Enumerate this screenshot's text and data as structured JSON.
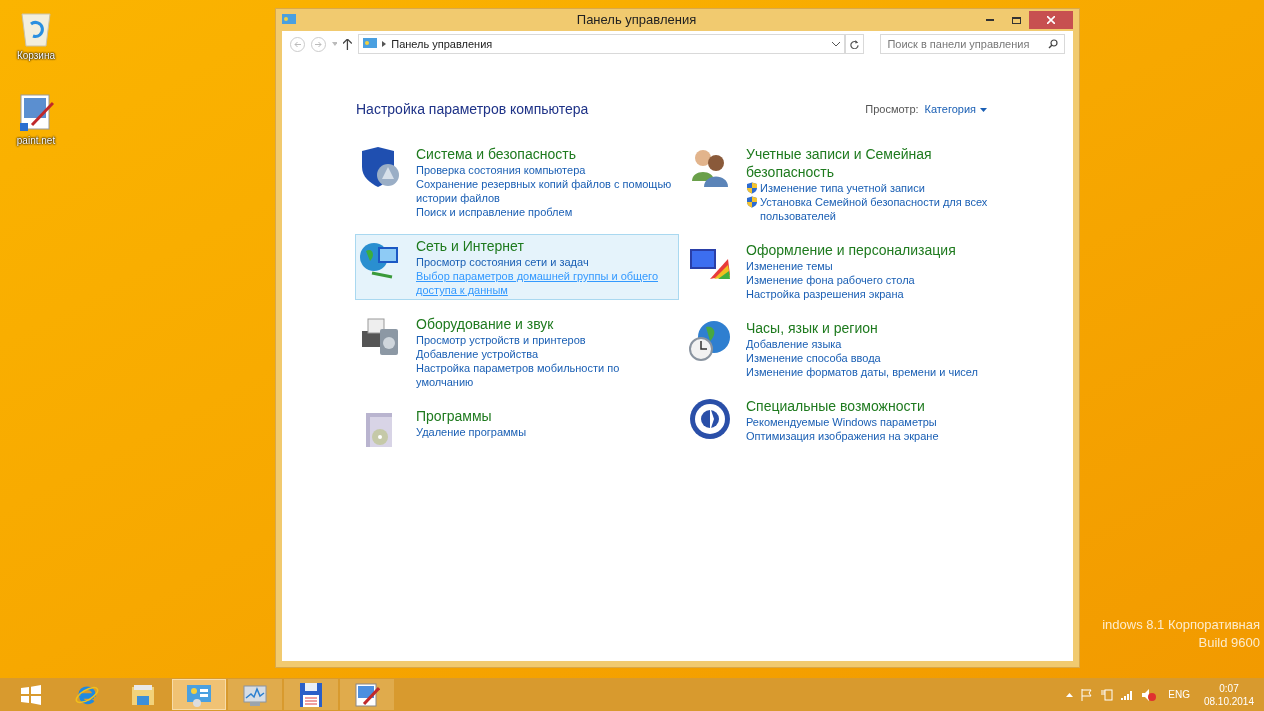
{
  "desktop_icons": [
    {
      "kind": "recycle",
      "label": "Корзина"
    },
    {
      "kind": "paint",
      "label": "paint.net"
    }
  ],
  "window": {
    "title": "Панель управления",
    "address": {
      "path": "Панель управления"
    },
    "search": {
      "placeholder": "Поиск в панели управления"
    },
    "heading": "Настройка параметров компьютера",
    "view_label": "Просмотр:",
    "view_value": "Категория",
    "columns": [
      [
        {
          "kind": "security",
          "title": "Система и безопасность",
          "selected": false,
          "links": [
            {
              "text": "Проверка состояния компьютера",
              "shield": false,
              "hovered": false
            },
            {
              "text": "Сохранение резервных копий файлов с помощью истории файлов",
              "shield": false,
              "hovered": false
            },
            {
              "text": "Поиск и исправление проблем",
              "shield": false,
              "hovered": false
            }
          ]
        },
        {
          "kind": "network",
          "title": "Сеть и Интернет",
          "selected": true,
          "links": [
            {
              "text": "Просмотр состояния сети и задач",
              "shield": false,
              "hovered": false
            },
            {
              "text": "Выбор параметров домашней группы и общего доступа к данным",
              "shield": false,
              "hovered": true
            }
          ]
        },
        {
          "kind": "hardware",
          "title": "Оборудование и звук",
          "selected": false,
          "links": [
            {
              "text": "Просмотр устройств и принтеров",
              "shield": false,
              "hovered": false
            },
            {
              "text": "Добавление устройства",
              "shield": false,
              "hovered": false
            },
            {
              "text": "Настройка параметров мобильности по умолчанию",
              "shield": false,
              "hovered": false
            }
          ]
        },
        {
          "kind": "programs",
          "title": "Программы",
          "selected": false,
          "links": [
            {
              "text": "Удаление программы",
              "shield": false,
              "hovered": false
            }
          ]
        }
      ],
      [
        {
          "kind": "users",
          "title": "Учетные записи и Семейная безопасность",
          "selected": false,
          "links": [
            {
              "text": "Изменение типа учетной записи",
              "shield": true,
              "hovered": false
            },
            {
              "text": "Установка Семейной безопасности для всех пользователей",
              "shield": true,
              "hovered": false
            }
          ]
        },
        {
          "kind": "appearance",
          "title": "Оформление и персонализация",
          "selected": false,
          "links": [
            {
              "text": "Изменение темы",
              "shield": false,
              "hovered": false
            },
            {
              "text": "Изменение фона рабочего стола",
              "shield": false,
              "hovered": false
            },
            {
              "text": "Настройка разрешения экрана",
              "shield": false,
              "hovered": false
            }
          ]
        },
        {
          "kind": "clock",
          "title": "Часы, язык и регион",
          "selected": false,
          "links": [
            {
              "text": "Добавление языка",
              "shield": false,
              "hovered": false
            },
            {
              "text": "Изменение способа ввода",
              "shield": false,
              "hovered": false
            },
            {
              "text": "Изменение форматов даты, времени и чисел",
              "shield": false,
              "hovered": false
            }
          ]
        },
        {
          "kind": "access",
          "title": "Специальные возможности",
          "selected": false,
          "links": [
            {
              "text": "Рекомендуемые Windows параметры",
              "shield": false,
              "hovered": false
            },
            {
              "text": "Оптимизация изображения на экране",
              "shield": false,
              "hovered": false
            }
          ]
        }
      ]
    ]
  },
  "watermark": {
    "edition": "indows 8.1 Корпоративная",
    "build": "Build 9600"
  },
  "taskbar": {
    "items": [
      {
        "kind": "start",
        "selected": false
      },
      {
        "kind": "ie",
        "selected": false
      },
      {
        "kind": "explorer",
        "selected": false
      },
      {
        "kind": "control",
        "selected": true
      },
      {
        "kind": "monitor",
        "selected": false
      },
      {
        "kind": "floppy",
        "selected": false
      },
      {
        "kind": "paint",
        "selected": false
      }
    ],
    "tray": {
      "language": "ENG",
      "time": "0:07",
      "date": "08.10.2014"
    }
  }
}
